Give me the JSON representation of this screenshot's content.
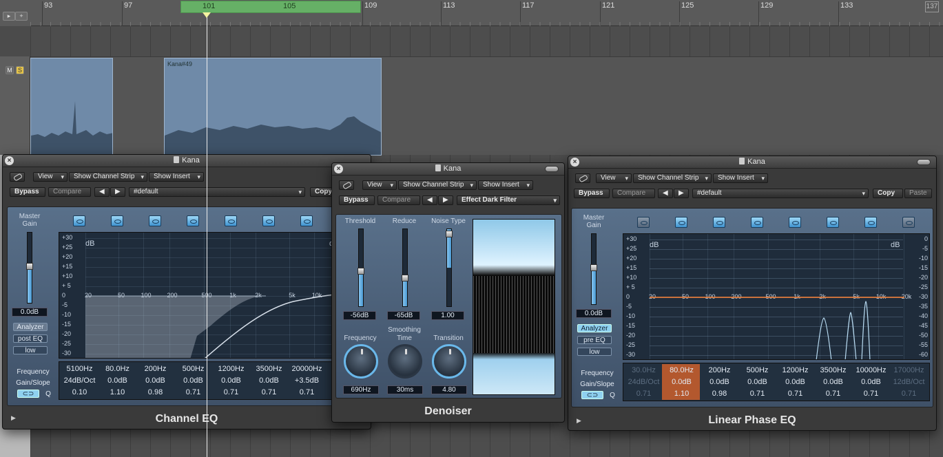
{
  "ruler": {
    "bars": [
      "93",
      "97",
      "101",
      "105",
      "109",
      "113",
      "117",
      "121",
      "125",
      "129",
      "133",
      "137"
    ],
    "tool_add_label": "+"
  },
  "track": {
    "mute_label": "M",
    "solo_label": "S"
  },
  "regions": [
    {
      "title": ""
    },
    {
      "title": "Kana#49"
    }
  ],
  "colors": {
    "accent": "#6ab8ea",
    "cycle": "#66b066",
    "region": "#6f8aa8",
    "linear_phase_curve": "#e07a3a"
  },
  "channel_eq": {
    "window_title": "Kana",
    "toolbar": {
      "view": "View",
      "show_channel_strip": "Show Channel Strip",
      "show_insert": "Show Insert"
    },
    "bypass": "Bypass",
    "compare": "Compare",
    "preset": "#default",
    "copy": "Copy",
    "master_gain_label": "Master Gain",
    "master_gain_value": "0.0dB",
    "analyzer": "Analyzer",
    "post_eq": "post EQ",
    "resolution": "low",
    "db_label": "dB",
    "db_ticks": [
      "+30",
      "+25",
      "+20",
      "+15",
      "+10",
      "+ 5",
      "0",
      "-5",
      "-10",
      "-15",
      "-20",
      "-25",
      "-30"
    ],
    "freq_ticks": [
      "20",
      "50",
      "100",
      "200",
      "500",
      "1k",
      "2k",
      "5k",
      "10k"
    ],
    "row_labels": {
      "frequency": "Frequency",
      "gain_slope": "Gain/Slope",
      "q": "Q"
    },
    "bands": [
      {
        "freq": "5100Hz",
        "gain": "24dB/Oct",
        "q": "0.10"
      },
      {
        "freq": "80.0Hz",
        "gain": "0.0dB",
        "q": "1.10"
      },
      {
        "freq": "200Hz",
        "gain": "0.0dB",
        "q": "0.98"
      },
      {
        "freq": "500Hz",
        "gain": "0.0dB",
        "q": "0.71"
      },
      {
        "freq": "1200Hz",
        "gain": "0.0dB",
        "q": "0.71"
      },
      {
        "freq": "3500Hz",
        "gain": "0.0dB",
        "q": "0.71"
      },
      {
        "freq": "20000Hz",
        "gain": "+3.5dB",
        "q": "0.71"
      }
    ],
    "name": "Channel EQ"
  },
  "denoiser": {
    "window_title": "Kana",
    "toolbar": {
      "view": "View",
      "show_channel_strip": "Show Channel Strip",
      "show_insert": "Show Insert"
    },
    "bypass": "Bypass",
    "compare": "Compare",
    "preset": "Effect Dark Filter",
    "threshold_label": "Threshold",
    "threshold_value": "-56dB",
    "reduce_label": "Reduce",
    "reduce_value": "-65dB",
    "noise_type_label": "Noise Type",
    "noise_type_value": "1.00",
    "smoothing_label": "Smoothing",
    "frequency_label": "Frequency",
    "frequency_value": "690Hz",
    "time_label": "Time",
    "time_value": "30ms",
    "transition_label": "Transition",
    "transition_value": "4.80",
    "name": "Denoiser"
  },
  "linear_phase_eq": {
    "window_title": "Kana",
    "toolbar": {
      "view": "View",
      "show_channel_strip": "Show Channel Strip",
      "show_insert": "Show Insert"
    },
    "bypass": "Bypass",
    "compare": "Compare",
    "preset": "#default",
    "copy": "Copy",
    "paste": "Paste",
    "master_gain_label": "Master Gain",
    "master_gain_value": "0.0dB",
    "analyzer": "Analyzer",
    "pre_eq": "pre EQ",
    "resolution": "low",
    "db_label": "dB",
    "db_ticks": [
      "+30",
      "+25",
      "+20",
      "+15",
      "+10",
      "+ 5",
      "0",
      "-5",
      "-10",
      "-15",
      "-20",
      "-25",
      "-30"
    ],
    "right_ticks": [
      "0",
      "-5",
      "-10",
      "-15",
      "-20",
      "-25",
      "-30",
      "-35",
      "-40",
      "-45",
      "-50",
      "-55",
      "-60"
    ],
    "freq_ticks": [
      "20",
      "50",
      "100",
      "200",
      "500",
      "1k",
      "2k",
      "5k",
      "10k",
      "20k"
    ],
    "row_labels": {
      "frequency": "Frequency",
      "gain_slope": "Gain/Slope",
      "q": "Q"
    },
    "bands": [
      {
        "freq": "30.0Hz",
        "gain": "24dB/Oct",
        "q": "0.71"
      },
      {
        "freq": "80.0Hz",
        "gain": "0.0dB",
        "q": "1.10"
      },
      {
        "freq": "200Hz",
        "gain": "0.0dB",
        "q": "0.98"
      },
      {
        "freq": "500Hz",
        "gain": "0.0dB",
        "q": "0.71"
      },
      {
        "freq": "1200Hz",
        "gain": "0.0dB",
        "q": "0.71"
      },
      {
        "freq": "3500Hz",
        "gain": "0.0dB",
        "q": "0.71"
      },
      {
        "freq": "10000Hz",
        "gain": "0.0dB",
        "q": "0.71"
      },
      {
        "freq": "17000Hz",
        "gain": "12dB/Oct",
        "q": "0.71"
      }
    ],
    "name": "Linear Phase EQ"
  }
}
